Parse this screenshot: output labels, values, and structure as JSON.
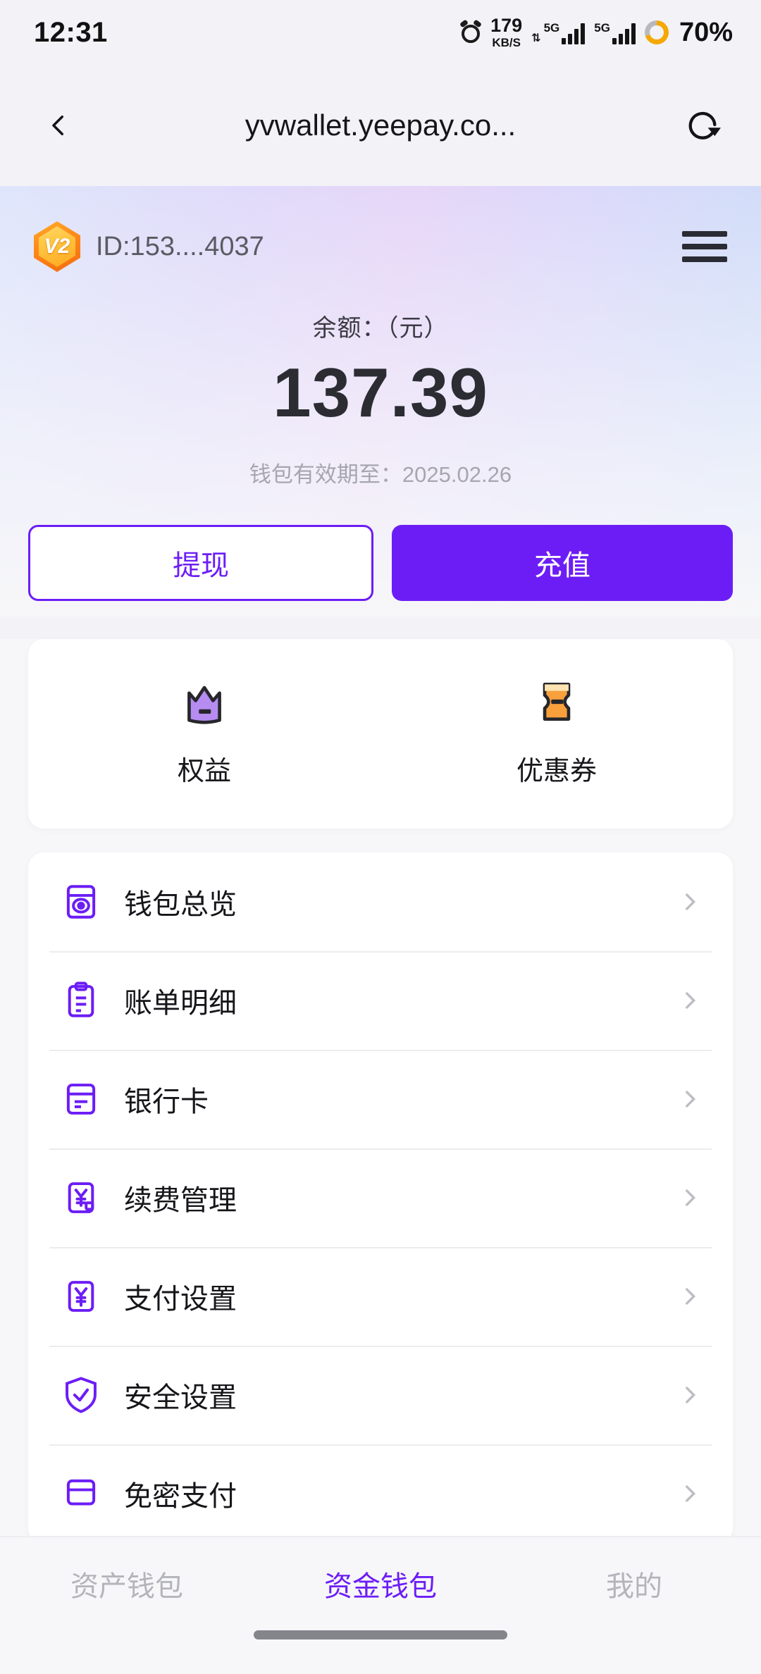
{
  "status_bar": {
    "time": "12:31",
    "alarm_icon": "alarm-icon",
    "network_speed_value": "179",
    "network_speed_unit": "KB/S",
    "sim1_label": "5G",
    "sim2_label": "5G",
    "battery_percent": "70%"
  },
  "browser": {
    "back_icon": "chevron-left-icon",
    "page_title": "yvwallet.yeepay.co...",
    "reload_icon": "reload-icon"
  },
  "hero": {
    "badge_text": "V2",
    "user_id": "ID:153....4037",
    "menu_icon": "hamburger-icon",
    "balance_label": "余额：（元）",
    "balance_amount": "137.39",
    "expiry_text": "钱包有效期至：2025.02.26",
    "withdraw_button": "提现",
    "recharge_button": "充值",
    "accent_color": "#6c1df6"
  },
  "quick_actions": [
    {
      "label": "权益",
      "icon": "crown-icon"
    },
    {
      "label": "优惠券",
      "icon": "coupon-icon"
    }
  ],
  "menu": {
    "items": [
      {
        "label": "钱包总览",
        "icon": "wallet-overview-icon"
      },
      {
        "label": "账单明细",
        "icon": "bill-details-icon"
      },
      {
        "label": "银行卡",
        "icon": "bank-card-icon"
      },
      {
        "label": "续费管理",
        "icon": "renewal-yuan-icon"
      },
      {
        "label": "支付设置",
        "icon": "payment-yuan-icon"
      },
      {
        "label": "安全设置",
        "icon": "shield-check-icon"
      },
      {
        "label": "免密支付",
        "icon": "passwordless-pay-icon"
      }
    ]
  },
  "tabbar": {
    "tabs": [
      {
        "label": "资产钱包",
        "active": false
      },
      {
        "label": "资金钱包",
        "active": true
      },
      {
        "label": "我的",
        "active": false
      }
    ]
  }
}
